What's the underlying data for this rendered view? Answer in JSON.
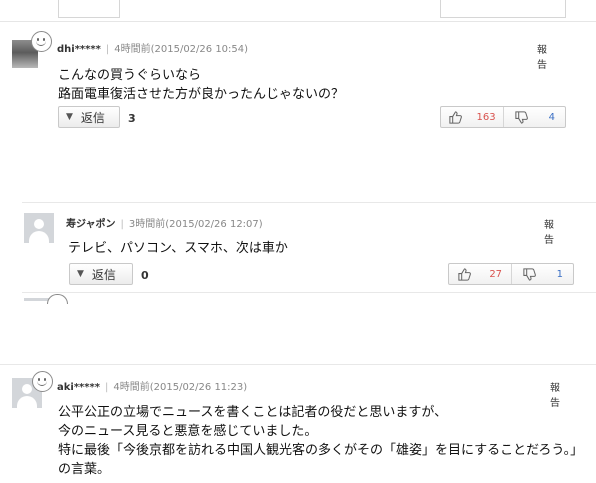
{
  "comments": [
    {
      "user": "dhi*****",
      "time": "4時間前(2015/02/26 10:54)",
      "report": "報告",
      "lines": [
        "こんなの買うぐらいなら",
        "路面電車復活させた方が良かったんじゃないの？"
      ],
      "reply_label": "返信",
      "reply_count": "3",
      "good": "163",
      "bad": "4"
    },
    {
      "user": "寿ジャポン",
      "time": "3時間前(2015/02/26 12:07)",
      "report": "報告",
      "lines": [
        "テレビ、パソコン、スマホ、次は車か"
      ],
      "reply_label": "返信",
      "reply_count": "0",
      "good": "27",
      "bad": "1"
    },
    {
      "user": "aki*****",
      "time": "4時間前(2015/02/26 11:23)",
      "report": "報告",
      "lines": [
        "公平公正の立場でニュースを書くことは記者の役だと思いますが、",
        "今のニュース見ると悪意を感じていました。",
        "特に最後「今後京都を訪れる中国人観光客の多くがその「雄姿」を目にすることだろう。」",
        "の言葉。"
      ]
    }
  ],
  "icons": {
    "reaction": "smile-icon",
    "good": "thumbs-up-icon",
    "bad": "thumbs-down-icon",
    "expand": "triangle-down-icon"
  },
  "colors": {
    "good": "#d9534f",
    "bad": "#3a6fc4"
  }
}
